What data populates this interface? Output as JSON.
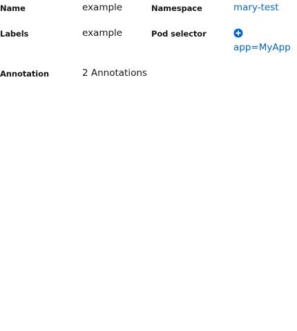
{
  "details": {
    "name": {
      "label": "Name",
      "value": "example"
    },
    "namespace": {
      "label": "Namespace",
      "value": "mary-test"
    },
    "labels": {
      "label": "Labels",
      "value": "example"
    },
    "pod_selector": {
      "label": "Pod selector",
      "icon": "plus-circle-icon",
      "value": "app=MyApp"
    },
    "annotation": {
      "label": "Annotation",
      "value": "2 Annotations"
    }
  },
  "colors": {
    "link": "#0066cc",
    "text": "#151515"
  }
}
